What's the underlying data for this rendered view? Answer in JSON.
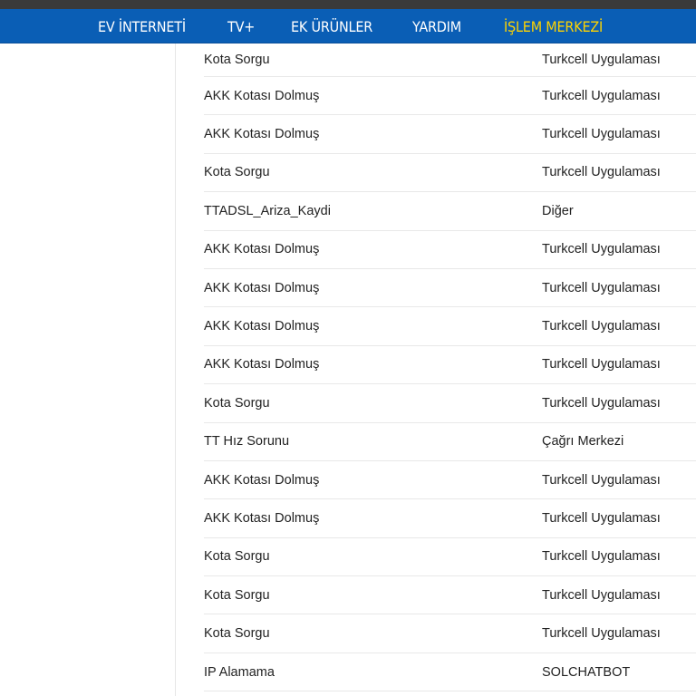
{
  "nav": {
    "items": [
      {
        "label": "EV İNTERNETİ"
      },
      {
        "label": "TV+"
      },
      {
        "label": "EK ÜRÜNLER"
      },
      {
        "label": "YARDIM"
      },
      {
        "label": "İŞLEM MERKEZİ",
        "active": true
      }
    ],
    "bar_color": "#0a5eb5",
    "active_color": "#ffd400"
  },
  "records": [
    {
      "name": "Kota Sorgu",
      "channel": "Turkcell Uygulaması"
    },
    {
      "name": "AKK Kotası Dolmuş",
      "channel": "Turkcell Uygulaması"
    },
    {
      "name": "AKK Kotası Dolmuş",
      "channel": "Turkcell Uygulaması"
    },
    {
      "name": "Kota Sorgu",
      "channel": "Turkcell Uygulaması"
    },
    {
      "name": "TTADSL_Ariza_Kaydi",
      "channel": "Diğer"
    },
    {
      "name": "AKK Kotası Dolmuş",
      "channel": "Turkcell Uygulaması"
    },
    {
      "name": "AKK Kotası Dolmuş",
      "channel": "Turkcell Uygulaması"
    },
    {
      "name": "AKK Kotası Dolmuş",
      "channel": "Turkcell Uygulaması"
    },
    {
      "name": "AKK Kotası Dolmuş",
      "channel": "Turkcell Uygulaması"
    },
    {
      "name": "Kota Sorgu",
      "channel": "Turkcell Uygulaması"
    },
    {
      "name": "TT Hız Sorunu",
      "channel": "Çağrı Merkezi"
    },
    {
      "name": "AKK Kotası Dolmuş",
      "channel": "Turkcell Uygulaması"
    },
    {
      "name": "AKK Kotası Dolmuş",
      "channel": "Turkcell Uygulaması"
    },
    {
      "name": "Kota Sorgu",
      "channel": "Turkcell Uygulaması"
    },
    {
      "name": "Kota Sorgu",
      "channel": "Turkcell Uygulaması"
    },
    {
      "name": "Kota Sorgu",
      "channel": "Turkcell Uygulaması"
    },
    {
      "name": "IP Alamama",
      "channel": "SOLCHATBOT"
    }
  ]
}
